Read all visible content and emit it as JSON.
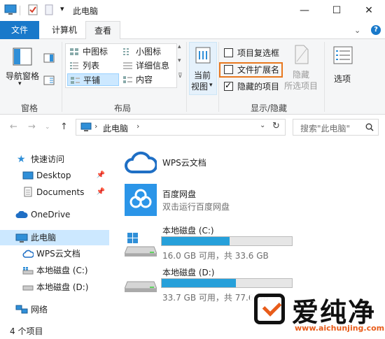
{
  "window": {
    "title": "此电脑",
    "controls": {
      "minimize": "—",
      "maximize": "☐",
      "close": "✕"
    }
  },
  "quick_access": {
    "dropdown": "▾"
  },
  "tabs": {
    "file": "文件",
    "computer": "计算机",
    "view": "查看",
    "expand": "⌄",
    "help": "?"
  },
  "ribbon": {
    "panes": {
      "nav_pane": "导航窗格",
      "group_label": "窗格"
    },
    "layout": {
      "items": {
        "medium_icons": "中图标",
        "small_icons": "小图标",
        "list": "列表",
        "details": "详细信息",
        "tiles": "平铺",
        "content": "内容"
      },
      "group_label": "布局"
    },
    "current_view": {
      "line1": "当前",
      "line2": "视图"
    },
    "show_hide": {
      "item_checkboxes": "项目复选框",
      "file_extensions": "文件扩展名",
      "hidden_items": "隐藏的项目",
      "hide_selected_line1": "隐藏",
      "hide_selected_line2": "所选项目",
      "options": "选项",
      "group_label": "显示/隐藏"
    }
  },
  "address": {
    "path": "此电脑",
    "search_placeholder": "搜索\"此电脑\""
  },
  "sidebar": {
    "items": [
      {
        "label": "快速访问"
      },
      {
        "label": "Desktop"
      },
      {
        "label": "Documents"
      },
      {
        "label": "OneDrive"
      },
      {
        "label": "此电脑"
      },
      {
        "label": "WPS云文档"
      },
      {
        "label": "本地磁盘 (C:)"
      },
      {
        "label": "本地磁盘 (D:)"
      },
      {
        "label": "网络"
      }
    ]
  },
  "main": {
    "items": [
      {
        "name": "WPS云文档"
      },
      {
        "name": "百度网盘",
        "sub": "双击运行百度网盘"
      },
      {
        "name": "本地磁盘 (C:)",
        "sub": "16.0 GB 可用，共 33.6 GB",
        "used_fraction": 0.52
      },
      {
        "name": "本地磁盘 (D:)",
        "sub": "33.7 GB 可用，共 77.6 GB",
        "used_fraction": 0.57
      }
    ]
  },
  "status": {
    "count": "4 个项目"
  },
  "watermark": {
    "text": "爱纯净",
    "url": "www.aichunjing.com"
  },
  "colors": {
    "accent": "#1979ca",
    "highlight": "#e8781f",
    "selection": "#cce8ff",
    "drive_bar": "#26a0da"
  }
}
